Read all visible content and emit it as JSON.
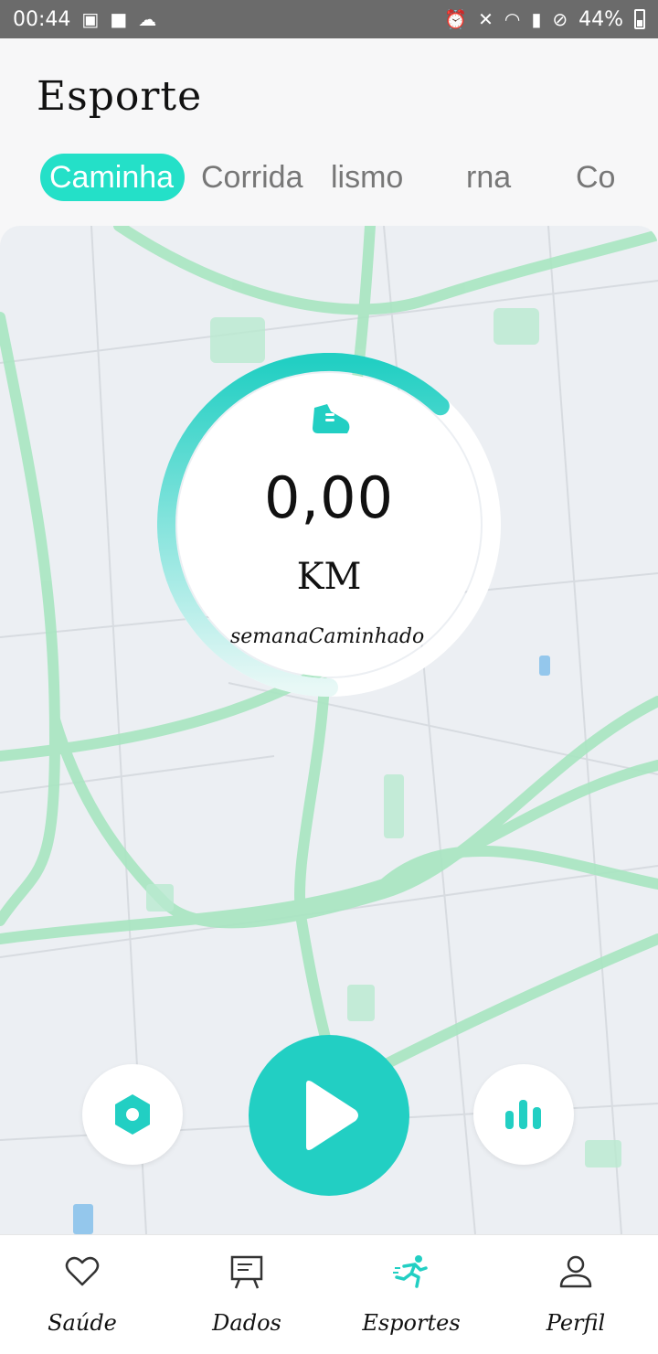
{
  "status_bar": {
    "time": "00:44",
    "battery": "44%",
    "left_icons": [
      "image-icon",
      "folder-icon",
      "cloud-icon"
    ],
    "right_icons": [
      "alarm-icon",
      "mute-icon",
      "wifi-icon",
      "signal-icon",
      "block-icon",
      "battery-icon"
    ]
  },
  "header": {
    "title": "Esporte"
  },
  "tabs": [
    {
      "label": "Caminha",
      "active": true
    },
    {
      "label": "Corrida",
      "active": false
    },
    {
      "label": "lismo",
      "active": false
    },
    {
      "label": "rna",
      "active": false
    },
    {
      "label": "Co",
      "active": false
    }
  ],
  "summary": {
    "icon": "shoe-icon",
    "distance": "0,00",
    "unit": "KM",
    "caption": "semanaCaminhado",
    "progress_fraction": 0.62
  },
  "controls": {
    "settings_icon": "settings-icon",
    "play_icon": "play-icon",
    "stats_icon": "bar-chart-icon"
  },
  "bottom_nav": [
    {
      "label": "Saúde",
      "icon": "heart-icon",
      "active": false
    },
    {
      "label": "Dados",
      "icon": "board-icon",
      "active": false
    },
    {
      "label": "Esportes",
      "icon": "runner-icon",
      "active": true
    },
    {
      "label": "Perfil",
      "icon": "person-icon",
      "active": false
    }
  ],
  "colors": {
    "accent": "#22cfc3",
    "tab_active_bg": "#24e0c8",
    "map_road": "#a8e6c1",
    "map_bg": "#eceff3"
  }
}
